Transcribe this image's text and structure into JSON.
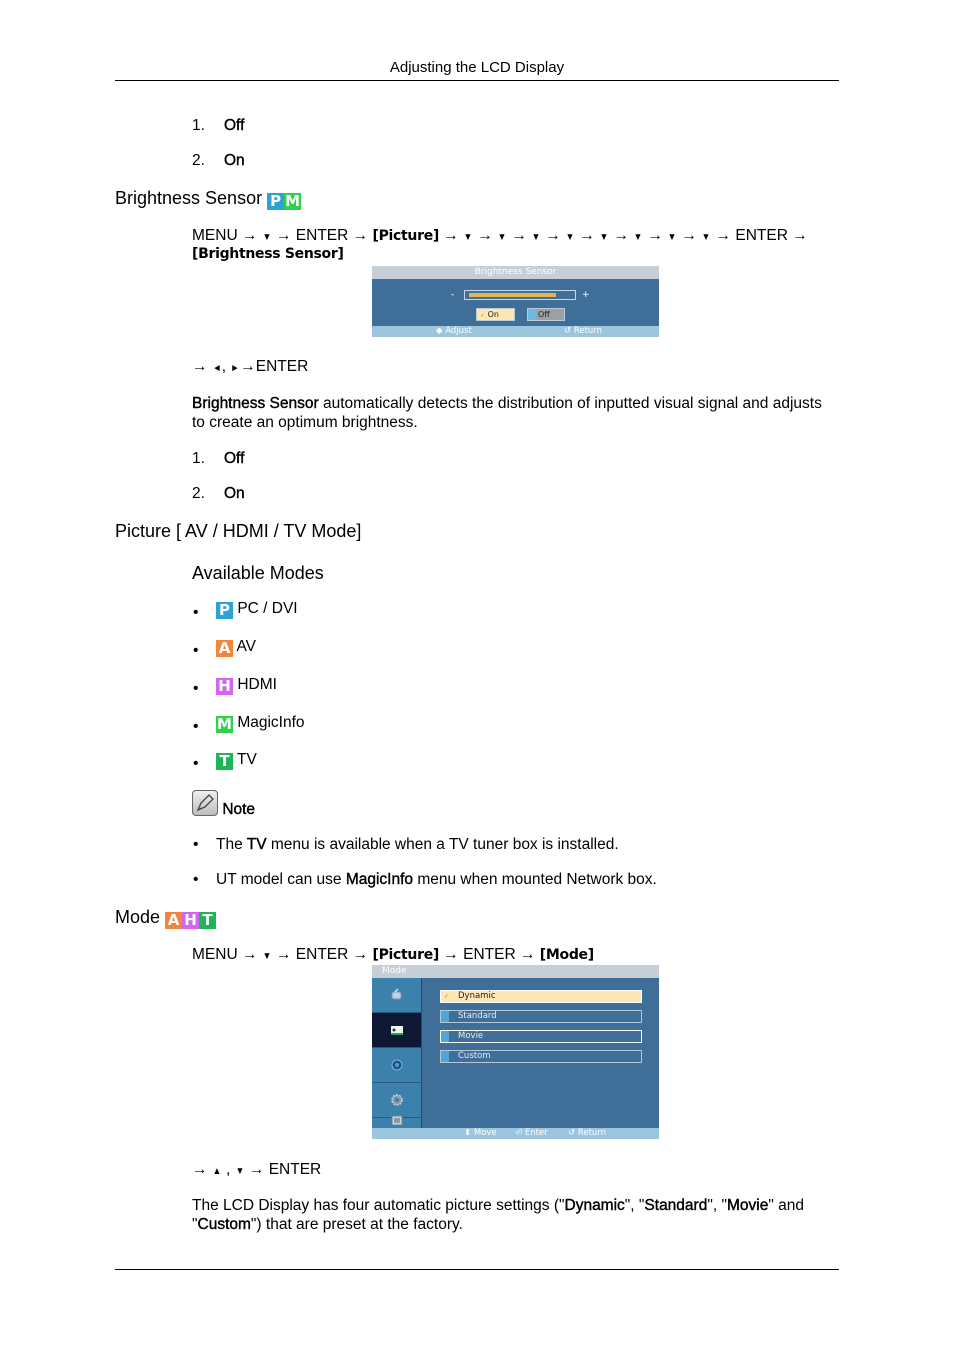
{
  "header": {
    "title": "Adjusting the LCD Display"
  },
  "top_list": [
    {
      "num": "1.",
      "label": "Off"
    },
    {
      "num": "2.",
      "label": "On"
    }
  ],
  "brightness_sensor": {
    "heading": "Brightness Sensor",
    "badges": [
      "P",
      "M"
    ],
    "path_line1": {
      "menu": "MENU",
      "arrow": "→",
      "down": "▼",
      "enter": "ENTER",
      "picture": "[Picture]"
    },
    "path_line2": "[Brightness Sensor]",
    "osd": {
      "title": "Brightness Sensor",
      "minus": "-",
      "plus": "+",
      "level_fraction": 0.85,
      "on_label": "On",
      "off_label": "Off",
      "check": "✓",
      "foot_adjust": "Adjust",
      "foot_return": "Return"
    },
    "nav_hint": {
      "arrow": "→",
      "left": "◄",
      "right": "►",
      "sep": ",",
      "enter": "ENTER"
    },
    "description_bold": "Brightness Sensor",
    "description_rest": " automatically detects the distribution of inputted visual signal and adjusts",
    "description_line2": "to create an optimum brightness.",
    "options": [
      {
        "num": "1.",
        "label": "Off"
      },
      {
        "num": "2.",
        "label": "On"
      }
    ]
  },
  "picture_section": {
    "heading": "Picture [ AV / HDMI / TV Mode]",
    "sub_heading": "Available Modes",
    "modes": [
      {
        "badge": "P",
        "label": "PC / DVI",
        "color": "#2ba3d6"
      },
      {
        "badge": "A",
        "label": "AV",
        "color": "#f5853a"
      },
      {
        "badge": "H",
        "label": "HDMI",
        "color": "#d565f0"
      },
      {
        "badge": "M",
        "label": "MagicInfo",
        "color": "#2fd24a"
      },
      {
        "badge": "T",
        "label": "TV",
        "color": "#1fb456"
      }
    ],
    "note_label": "Note",
    "notes": [
      {
        "pre": "The ",
        "bold": "TV",
        "post": " menu is available when a TV tuner box is installed."
      },
      {
        "pre": "UT model can use ",
        "bold": "MagicInfo",
        "post": " menu when mounted Network box."
      }
    ]
  },
  "mode_section": {
    "heading": "Mode",
    "badges": [
      "A",
      "H",
      "T"
    ],
    "path": {
      "menu": "MENU",
      "arrow": "→",
      "down": "▼",
      "enter": "ENTER",
      "picture": "[Picture]",
      "mode": "[Mode]"
    },
    "osd": {
      "title": "Mode",
      "sidebar_icons": [
        "input-icon",
        "picture-icon",
        "sound-icon",
        "setup-icon",
        "multi-control-icon"
      ],
      "selected_sidebar_index": 1,
      "items": [
        "Dynamic",
        "Standard",
        "Movie",
        "Custom"
      ],
      "selected_item": "Dynamic",
      "check": "✓",
      "foot_move": "Move",
      "foot_enter": "Enter",
      "foot_return": "Return"
    },
    "nav_hint": {
      "arrow": "→",
      "up": "▲",
      "down": "▼",
      "sep": ",",
      "enter": "ENTER"
    },
    "description": {
      "p1": "The LCD Display has four automatic picture settings (\"",
      "b1": "Dynamic",
      "p2": "\", \"",
      "b2": "Standard",
      "p3": "\", \"",
      "b3": "Movie",
      "p4": "\" and",
      "p5": "\"",
      "b4": "Custom",
      "p6": "\") that are preset at the factory."
    }
  }
}
